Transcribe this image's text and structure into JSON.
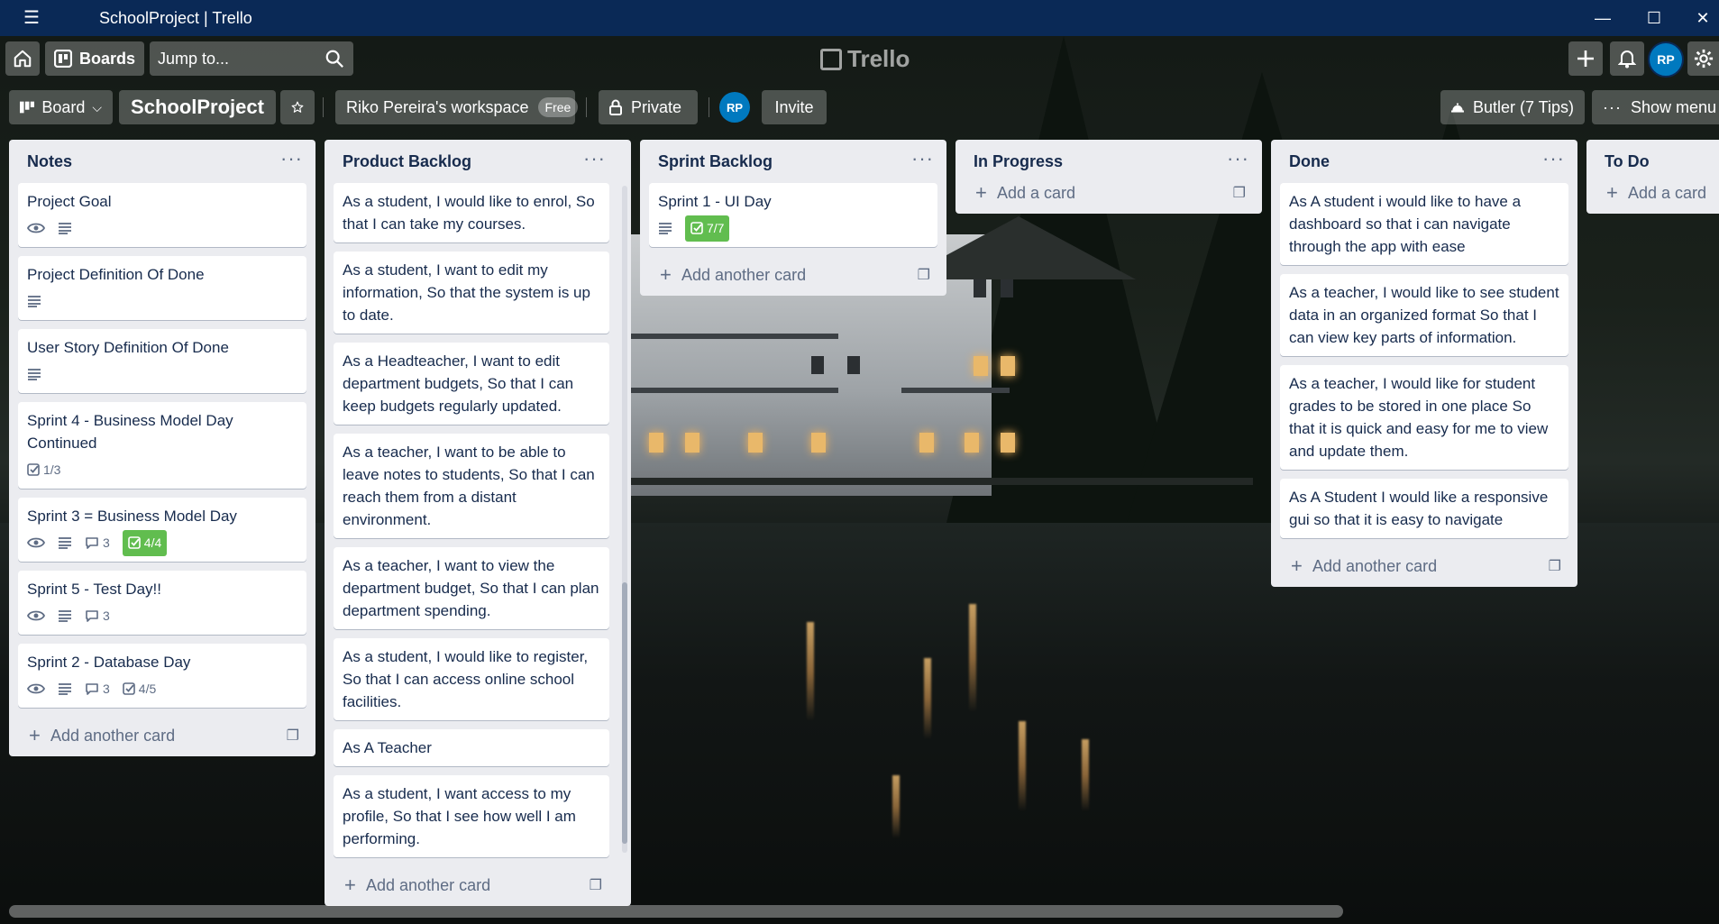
{
  "window": {
    "title": "SchoolProject | Trello",
    "menu_icon": "hamburger-icon",
    "minimize_glyph": "—",
    "maximize_glyph": "☐",
    "close_glyph": "✕"
  },
  "header": {
    "boards_label": "Boards",
    "search_placeholder": "Jump to...",
    "logo_text": "Trello",
    "avatar_initials": "RP"
  },
  "board_bar": {
    "board_view_label": "Board",
    "board_name": "SchoolProject",
    "workspace_label": "Riko Pereira's workspace",
    "workspace_badge": "Free",
    "visibility_label": "Private",
    "member_initials": "RP",
    "invite_label": "Invite",
    "butler_label": "Butler (7 Tips)",
    "show_menu_label": "Show menu"
  },
  "lists": [
    {
      "title": "Notes",
      "add_label": "Add another card",
      "cards": [
        {
          "title": "Project Goal",
          "badges": {
            "watch": true,
            "description": true
          }
        },
        {
          "title": "Project Definition Of Done",
          "badges": {
            "description": true
          }
        },
        {
          "title": "User Story Definition Of Done",
          "badges": {
            "description": true
          }
        },
        {
          "title": "Sprint 4 - Business Model Day Continued",
          "badges": {
            "checklist": "1/3"
          }
        },
        {
          "title": "Sprint 3 = Business Model Day",
          "badges": {
            "watch": true,
            "description": true,
            "comments": "3",
            "checklist_complete": "4/4"
          }
        },
        {
          "title": "Sprint 5 - Test Day!!",
          "badges": {
            "watch": true,
            "description": true,
            "comments": "3"
          }
        },
        {
          "title": "Sprint 2 - Database Day",
          "badges": {
            "watch": true,
            "description": true,
            "comments": "3",
            "checklist": "4/5"
          }
        }
      ]
    },
    {
      "title": "Product Backlog",
      "add_label": "Add another card",
      "cards": [
        {
          "title": "As a student, I would like to enrol, So that I can take my courses."
        },
        {
          "title": "As a student, I want to edit my information, So that the system is up to date."
        },
        {
          "title": "As a Headteacher, I want to edit department budgets, So that I can keep budgets regularly updated."
        },
        {
          "title": "As a teacher, I want to be able to leave notes to students, So that I can reach them from a distant environment."
        },
        {
          "title": "As a teacher, I want to view the department budget, So that I can plan department spending."
        },
        {
          "title": "As a student, I would like to register, So that I can access online school facilities."
        },
        {
          "title": "As A Teacher"
        },
        {
          "title": "As a student, I want access to my profile, So that I see how well I am performing."
        }
      ]
    },
    {
      "title": "Sprint Backlog",
      "add_label": "Add another card",
      "cards": [
        {
          "title": "Sprint 1 - UI Day",
          "badges": {
            "description": true,
            "checklist_complete": "7/7"
          }
        }
      ]
    },
    {
      "title": "In Progress",
      "add_label": "Add a card",
      "cards": []
    },
    {
      "title": "Done",
      "add_label": "Add another card",
      "cards": [
        {
          "title": "As A student i would like to have a dashboard so that i can navigate through the app with ease"
        },
        {
          "title": "As a teacher, I would like to see student data in an organized format So that I can view key parts of information."
        },
        {
          "title": "As a teacher, I would like for student grades to be stored in one place So that it is quick and easy for me to view and update them."
        },
        {
          "title": "As A Student I would like a responsive gui so that it is easy to navigate"
        }
      ]
    },
    {
      "title": "To Do",
      "add_label": "Add a card",
      "cards": []
    }
  ],
  "colors": {
    "title_bar": "#0a2956",
    "list_bg": "#ebecf0",
    "checklist_done": "#61bd4f",
    "avatar": "#0079bf"
  }
}
